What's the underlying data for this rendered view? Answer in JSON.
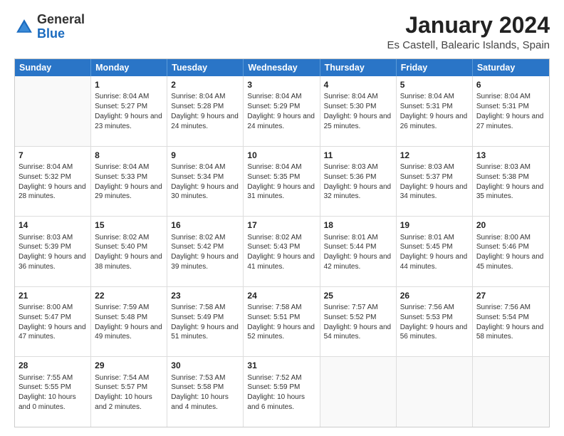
{
  "logo": {
    "general": "General",
    "blue": "Blue"
  },
  "title": "January 2024",
  "subtitle": "Es Castell, Balearic Islands, Spain",
  "headers": [
    "Sunday",
    "Monday",
    "Tuesday",
    "Wednesday",
    "Thursday",
    "Friday",
    "Saturday"
  ],
  "rows": [
    [
      {
        "day": "",
        "sunrise": "",
        "sunset": "",
        "daylight": "",
        "empty": true
      },
      {
        "day": "1",
        "sunrise": "Sunrise: 8:04 AM",
        "sunset": "Sunset: 5:27 PM",
        "daylight": "Daylight: 9 hours and 23 minutes.",
        "empty": false
      },
      {
        "day": "2",
        "sunrise": "Sunrise: 8:04 AM",
        "sunset": "Sunset: 5:28 PM",
        "daylight": "Daylight: 9 hours and 24 minutes.",
        "empty": false
      },
      {
        "day": "3",
        "sunrise": "Sunrise: 8:04 AM",
        "sunset": "Sunset: 5:29 PM",
        "daylight": "Daylight: 9 hours and 24 minutes.",
        "empty": false
      },
      {
        "day": "4",
        "sunrise": "Sunrise: 8:04 AM",
        "sunset": "Sunset: 5:30 PM",
        "daylight": "Daylight: 9 hours and 25 minutes.",
        "empty": false
      },
      {
        "day": "5",
        "sunrise": "Sunrise: 8:04 AM",
        "sunset": "Sunset: 5:31 PM",
        "daylight": "Daylight: 9 hours and 26 minutes.",
        "empty": false
      },
      {
        "day": "6",
        "sunrise": "Sunrise: 8:04 AM",
        "sunset": "Sunset: 5:31 PM",
        "daylight": "Daylight: 9 hours and 27 minutes.",
        "empty": false
      }
    ],
    [
      {
        "day": "7",
        "sunrise": "Sunrise: 8:04 AM",
        "sunset": "Sunset: 5:32 PM",
        "daylight": "Daylight: 9 hours and 28 minutes.",
        "empty": false
      },
      {
        "day": "8",
        "sunrise": "Sunrise: 8:04 AM",
        "sunset": "Sunset: 5:33 PM",
        "daylight": "Daylight: 9 hours and 29 minutes.",
        "empty": false
      },
      {
        "day": "9",
        "sunrise": "Sunrise: 8:04 AM",
        "sunset": "Sunset: 5:34 PM",
        "daylight": "Daylight: 9 hours and 30 minutes.",
        "empty": false
      },
      {
        "day": "10",
        "sunrise": "Sunrise: 8:04 AM",
        "sunset": "Sunset: 5:35 PM",
        "daylight": "Daylight: 9 hours and 31 minutes.",
        "empty": false
      },
      {
        "day": "11",
        "sunrise": "Sunrise: 8:03 AM",
        "sunset": "Sunset: 5:36 PM",
        "daylight": "Daylight: 9 hours and 32 minutes.",
        "empty": false
      },
      {
        "day": "12",
        "sunrise": "Sunrise: 8:03 AM",
        "sunset": "Sunset: 5:37 PM",
        "daylight": "Daylight: 9 hours and 34 minutes.",
        "empty": false
      },
      {
        "day": "13",
        "sunrise": "Sunrise: 8:03 AM",
        "sunset": "Sunset: 5:38 PM",
        "daylight": "Daylight: 9 hours and 35 minutes.",
        "empty": false
      }
    ],
    [
      {
        "day": "14",
        "sunrise": "Sunrise: 8:03 AM",
        "sunset": "Sunset: 5:39 PM",
        "daylight": "Daylight: 9 hours and 36 minutes.",
        "empty": false
      },
      {
        "day": "15",
        "sunrise": "Sunrise: 8:02 AM",
        "sunset": "Sunset: 5:40 PM",
        "daylight": "Daylight: 9 hours and 38 minutes.",
        "empty": false
      },
      {
        "day": "16",
        "sunrise": "Sunrise: 8:02 AM",
        "sunset": "Sunset: 5:42 PM",
        "daylight": "Daylight: 9 hours and 39 minutes.",
        "empty": false
      },
      {
        "day": "17",
        "sunrise": "Sunrise: 8:02 AM",
        "sunset": "Sunset: 5:43 PM",
        "daylight": "Daylight: 9 hours and 41 minutes.",
        "empty": false
      },
      {
        "day": "18",
        "sunrise": "Sunrise: 8:01 AM",
        "sunset": "Sunset: 5:44 PM",
        "daylight": "Daylight: 9 hours and 42 minutes.",
        "empty": false
      },
      {
        "day": "19",
        "sunrise": "Sunrise: 8:01 AM",
        "sunset": "Sunset: 5:45 PM",
        "daylight": "Daylight: 9 hours and 44 minutes.",
        "empty": false
      },
      {
        "day": "20",
        "sunrise": "Sunrise: 8:00 AM",
        "sunset": "Sunset: 5:46 PM",
        "daylight": "Daylight: 9 hours and 45 minutes.",
        "empty": false
      }
    ],
    [
      {
        "day": "21",
        "sunrise": "Sunrise: 8:00 AM",
        "sunset": "Sunset: 5:47 PM",
        "daylight": "Daylight: 9 hours and 47 minutes.",
        "empty": false
      },
      {
        "day": "22",
        "sunrise": "Sunrise: 7:59 AM",
        "sunset": "Sunset: 5:48 PM",
        "daylight": "Daylight: 9 hours and 49 minutes.",
        "empty": false
      },
      {
        "day": "23",
        "sunrise": "Sunrise: 7:58 AM",
        "sunset": "Sunset: 5:49 PM",
        "daylight": "Daylight: 9 hours and 51 minutes.",
        "empty": false
      },
      {
        "day": "24",
        "sunrise": "Sunrise: 7:58 AM",
        "sunset": "Sunset: 5:51 PM",
        "daylight": "Daylight: 9 hours and 52 minutes.",
        "empty": false
      },
      {
        "day": "25",
        "sunrise": "Sunrise: 7:57 AM",
        "sunset": "Sunset: 5:52 PM",
        "daylight": "Daylight: 9 hours and 54 minutes.",
        "empty": false
      },
      {
        "day": "26",
        "sunrise": "Sunrise: 7:56 AM",
        "sunset": "Sunset: 5:53 PM",
        "daylight": "Daylight: 9 hours and 56 minutes.",
        "empty": false
      },
      {
        "day": "27",
        "sunrise": "Sunrise: 7:56 AM",
        "sunset": "Sunset: 5:54 PM",
        "daylight": "Daylight: 9 hours and 58 minutes.",
        "empty": false
      }
    ],
    [
      {
        "day": "28",
        "sunrise": "Sunrise: 7:55 AM",
        "sunset": "Sunset: 5:55 PM",
        "daylight": "Daylight: 10 hours and 0 minutes.",
        "empty": false
      },
      {
        "day": "29",
        "sunrise": "Sunrise: 7:54 AM",
        "sunset": "Sunset: 5:57 PM",
        "daylight": "Daylight: 10 hours and 2 minutes.",
        "empty": false
      },
      {
        "day": "30",
        "sunrise": "Sunrise: 7:53 AM",
        "sunset": "Sunset: 5:58 PM",
        "daylight": "Daylight: 10 hours and 4 minutes.",
        "empty": false
      },
      {
        "day": "31",
        "sunrise": "Sunrise: 7:52 AM",
        "sunset": "Sunset: 5:59 PM",
        "daylight": "Daylight: 10 hours and 6 minutes.",
        "empty": false
      },
      {
        "day": "",
        "sunrise": "",
        "sunset": "",
        "daylight": "",
        "empty": true
      },
      {
        "day": "",
        "sunrise": "",
        "sunset": "",
        "daylight": "",
        "empty": true
      },
      {
        "day": "",
        "sunrise": "",
        "sunset": "",
        "daylight": "",
        "empty": true
      }
    ]
  ]
}
